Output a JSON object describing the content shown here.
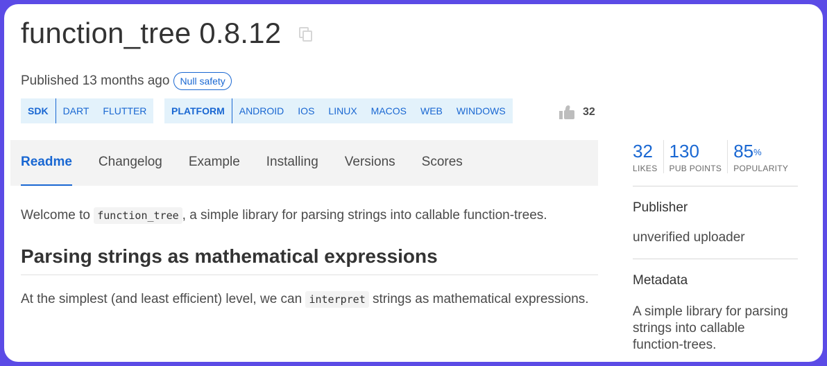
{
  "header": {
    "title": "function_tree 0.8.12",
    "published_prefix": "Published ",
    "published_age": "13 months ago",
    "null_safety": "Null safety"
  },
  "tags": {
    "sdk": {
      "label": "SDK",
      "items": [
        "DART",
        "FLUTTER"
      ]
    },
    "platform": {
      "label": "PLATFORM",
      "items": [
        "ANDROID",
        "IOS",
        "LINUX",
        "MACOS",
        "WEB",
        "WINDOWS"
      ]
    }
  },
  "likes_inline": "32",
  "tabs": [
    "Readme",
    "Changelog",
    "Example",
    "Installing",
    "Versions",
    "Scores"
  ],
  "active_tab": "Readme",
  "content": {
    "intro_before": "Welcome to ",
    "intro_code": "function_tree",
    "intro_after": ", a simple library for parsing strings into callable function-trees.",
    "heading": "Parsing strings as mathematical expressions",
    "p2_before": "At the simplest (and least efficient) level, we can ",
    "p2_code": "interpret",
    "p2_after": " strings as mathematical expressions."
  },
  "sidebar": {
    "stats": [
      {
        "value": "32",
        "suffix": "",
        "label": "LIKES"
      },
      {
        "value": "130",
        "suffix": "",
        "label": "PUB POINTS"
      },
      {
        "value": "85",
        "suffix": "%",
        "label": "POPULARITY"
      }
    ],
    "publisher_heading": "Publisher",
    "publisher_value": "unverified uploader",
    "metadata_heading": "Metadata",
    "metadata_value": "A simple library for parsing strings into callable function-trees."
  },
  "colors": {
    "accent": "#1967d2",
    "frame": "#5b4be6",
    "tag_bg": "#e3f2fb",
    "tabs_bg": "#f3f3f3"
  }
}
